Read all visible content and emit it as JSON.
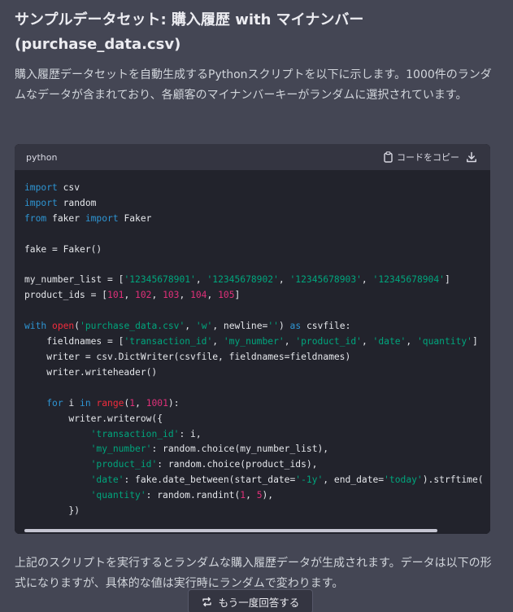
{
  "heading": {
    "line1": "サンプルデータセット: 購入履歴 with マイナンバー",
    "line2": "(purchase_data.csv)"
  },
  "intro": {
    "text": "購入履歴データセットを自動生成するPythonスクリプトを以下に示します。1000件のランダムなデータが含まれており、各顧客のマイナンバーキーがランダムに選択されています。"
  },
  "code": {
    "language": "python",
    "copy_label": "コードをコピー",
    "icons": {
      "copy": "clipboard-icon",
      "download": "download-icon"
    },
    "lines": [
      "import csv",
      "import random",
      "from faker import Faker",
      "",
      "fake = Faker()",
      "",
      "my_number_list = ['12345678901', '12345678902', '12345678903', '12345678904']",
      "product_ids = [101, 102, 103, 104, 105]",
      "",
      "with open('purchase_data.csv', 'w', newline='') as csvfile:",
      "    fieldnames = ['transaction_id', 'my_number', 'product_id', 'date', 'quantity']",
      "    writer = csv.DictWriter(csvfile, fieldnames=fieldnames)",
      "    writer.writeheader()",
      "",
      "    for i in range(1, 1001):",
      "        writer.writerow({",
      "            'transaction_id': i,",
      "            'my_number': random.choice(my_number_list),",
      "            'product_id': random.choice(product_ids),",
      "            'date': fake.date_between(start_date='-1y', end_date='today').strftime(",
      "            'quantity': random.randint(1, 5),",
      "        })"
    ]
  },
  "outro": {
    "text": "上記のスクリプトを実行するとランダムな購入履歴データが生成されます。データは以下の形式になりますが、具体的な値は実行時にランダムで変わります。"
  },
  "regenerate": {
    "label": "もう一度回答する",
    "icon": "regenerate-icon"
  },
  "colors": {
    "background": "#444654",
    "code_background": "#22232c",
    "code_header": "#343541",
    "keyword": "#2e95d3",
    "string": "#00a67d",
    "number": "#df3079",
    "builtin": "#f22c3d"
  }
}
